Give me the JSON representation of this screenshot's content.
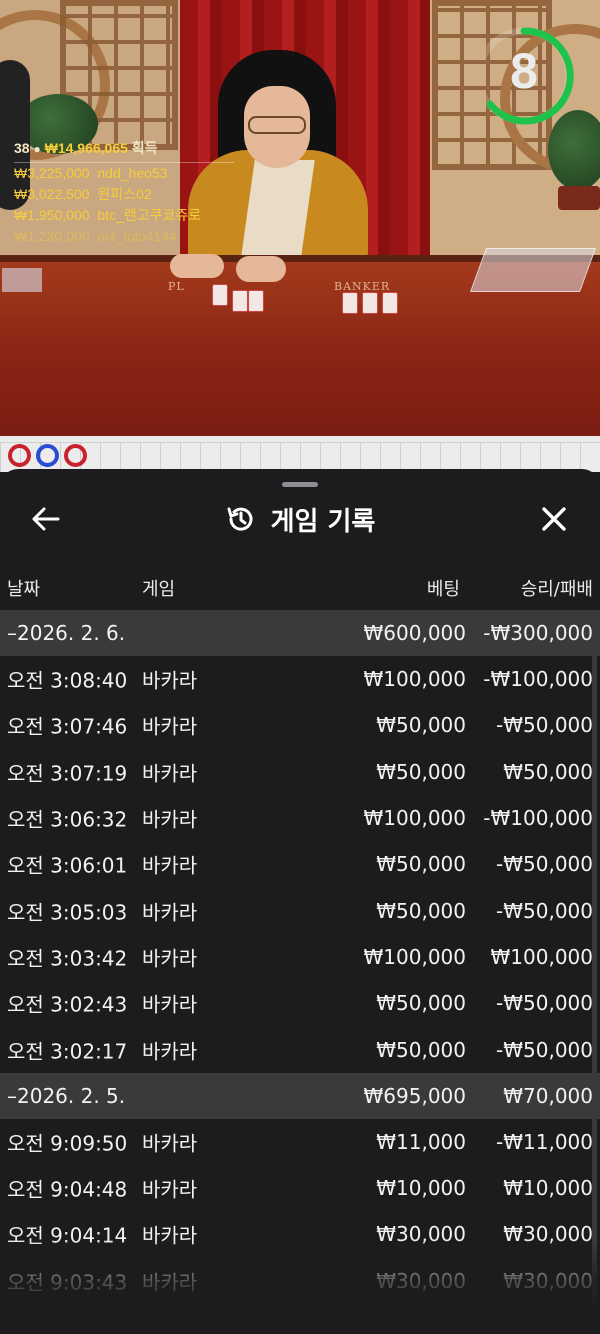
{
  "video": {
    "timer": "8",
    "colors": {
      "timer_ring": "#1fc34b",
      "winner_amount": "#f6cd3a"
    },
    "table_labels": {
      "player": "PL",
      "banker": "BANKER"
    },
    "winners": {
      "count": "38",
      "total": "₩14,966,065",
      "suffix": "획득",
      "rows": [
        {
          "amount": "₩3,225,000",
          "name": "ndd_heo53"
        },
        {
          "amount": "₩3,022,500",
          "name": "원피스02"
        },
        {
          "amount": "₩1,950,000",
          "name": "btc_렌고쿠쿄쥬로"
        },
        {
          "amount": "₩1,230,000",
          "name": "ai4_lolo4144"
        }
      ]
    }
  },
  "sheet": {
    "title": "게임 기록",
    "icons": {
      "back": "arrow-left-icon",
      "history": "history-icon",
      "close": "close-icon"
    },
    "columns": {
      "date": "날짜",
      "game": "게임",
      "bet": "베팅",
      "result": "승리/패배"
    },
    "rows": [
      {
        "time": "–2026. 2. 6.",
        "game": "",
        "bet": "₩600,000",
        "result": "-₩300,000",
        "group": true
      },
      {
        "time": "오전 3:08:40",
        "game": "바카라",
        "bet": "₩100,000",
        "result": "-₩100,000"
      },
      {
        "time": "오전 3:07:46",
        "game": "바카라",
        "bet": "₩50,000",
        "result": "-₩50,000"
      },
      {
        "time": "오전 3:07:19",
        "game": "바카라",
        "bet": "₩50,000",
        "result": "₩50,000"
      },
      {
        "time": "오전 3:06:32",
        "game": "바카라",
        "bet": "₩100,000",
        "result": "-₩100,000"
      },
      {
        "time": "오전 3:06:01",
        "game": "바카라",
        "bet": "₩50,000",
        "result": "-₩50,000"
      },
      {
        "time": "오전 3:05:03",
        "game": "바카라",
        "bet": "₩50,000",
        "result": "-₩50,000"
      },
      {
        "time": "오전 3:03:42",
        "game": "바카라",
        "bet": "₩100,000",
        "result": "₩100,000"
      },
      {
        "time": "오전 3:02:43",
        "game": "바카라",
        "bet": "₩50,000",
        "result": "-₩50,000"
      },
      {
        "time": "오전 3:02:17",
        "game": "바카라",
        "bet": "₩50,000",
        "result": "-₩50,000"
      },
      {
        "time": "–2026. 2. 5.",
        "game": "",
        "bet": "₩695,000",
        "result": "₩70,000",
        "group": true
      },
      {
        "time": "오전 9:09:50",
        "game": "바카라",
        "bet": "₩11,000",
        "result": "-₩11,000"
      },
      {
        "time": "오전 9:04:48",
        "game": "바카라",
        "bet": "₩10,000",
        "result": "₩10,000"
      },
      {
        "time": "오전 9:04:14",
        "game": "바카라",
        "bet": "₩30,000",
        "result": "₩30,000"
      },
      {
        "time": "오전 9:03:43",
        "game": "바카라",
        "bet": "₩30,000",
        "result": "₩30,000"
      }
    ]
  }
}
